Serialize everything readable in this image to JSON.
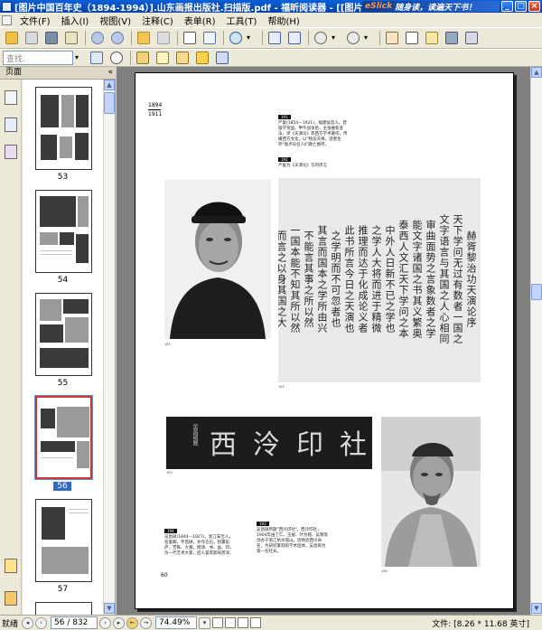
{
  "window": {
    "title": "[图片中国百年史（1894-1994）].山东画报出版社.扫描版.pdf - 福昕阅读器 - [[图片中国百年史（1894-1994...",
    "banner_brand": "eSlick",
    "banner_text": "随身读，读遍天下书！"
  },
  "menu": [
    "文件(F)",
    "插入(I)",
    "视图(V)",
    "注释(C)",
    "表单(R)",
    "工具(T)",
    "帮助(H)"
  ],
  "search": {
    "placeholder": "查找:"
  },
  "panel": {
    "title": "页面",
    "collapse": "«"
  },
  "thumbnails": [
    {
      "label": "53"
    },
    {
      "label": "54"
    },
    {
      "label": "55"
    },
    {
      "label": "56"
    },
    {
      "label": "57"
    }
  ],
  "page": {
    "year_top": "1894",
    "year_bottom": "1911",
    "caption1_tag": "191",
    "caption1_text": "严复(1854—1921)，福建侯官人。曾留学英国，甲午战争后，主张维新变法，译《天演论》等西方学术著作，传播西方文化，以\"物竞天择，适者生存\"观点号召人们救亡图存。",
    "caption2_tag": "192",
    "caption2_text": "严复为《天演论》写的序言",
    "photo1_num": "191",
    "calli_num": "192",
    "calli_cols": [
      "赫胥黎治功天演论序",
      "天下学问无过有数者一国之",
      "文字语言与其国之人心相同",
      "审曲面势之言象数者之学",
      "能文字诸国之书其义繁奥",
      "泰西人文汇天下学问之本",
      "中外人日新不已之学也",
      "之学人大将而进于精微",
      "推理而达于化成论义者",
      "此书所言今日之天演也",
      "之学明而不可忽者也",
      "其言而国本之学所由兴",
      "不能言其事之所以然",
      "一国本能不知其所以然",
      "而言之以身其国之大"
    ],
    "plaque_text": "西泠印社",
    "plaque_seal": "吴昌硕题",
    "plaque_num": "193",
    "caption3_tag": "194",
    "caption3_text": "吴昌硕(1844—1927)，浙江安吉人，名俊卿，字昌硕，亦作仓石，别署缶庐、苦铁、大聋。擅诗、书、画、印，为一代艺术大家，后人誉其影响甚深。",
    "caption4_tag": "193",
    "caption4_text": "吴昌硕所题\"西泠印社\"。西泠印社，1904年由丁仁、王褆、叶为铭、吴隐等创办于浙江杭州孤山，因地近西泠命名，为研究篆刻的学术团体。吴昌硕为第一任社长。",
    "photo2_num": "194",
    "page_num": "60"
  },
  "status": {
    "ready": "就绪",
    "page": "56 / 832",
    "zoom": "74.49%",
    "file_size": "文件: [8.26 * 11.68 英寸]"
  },
  "colors": {
    "titlebar": "#0a5fd8",
    "chrome": "#ece9d8",
    "doc_bg": "#808080",
    "selection": "#cc3333"
  }
}
